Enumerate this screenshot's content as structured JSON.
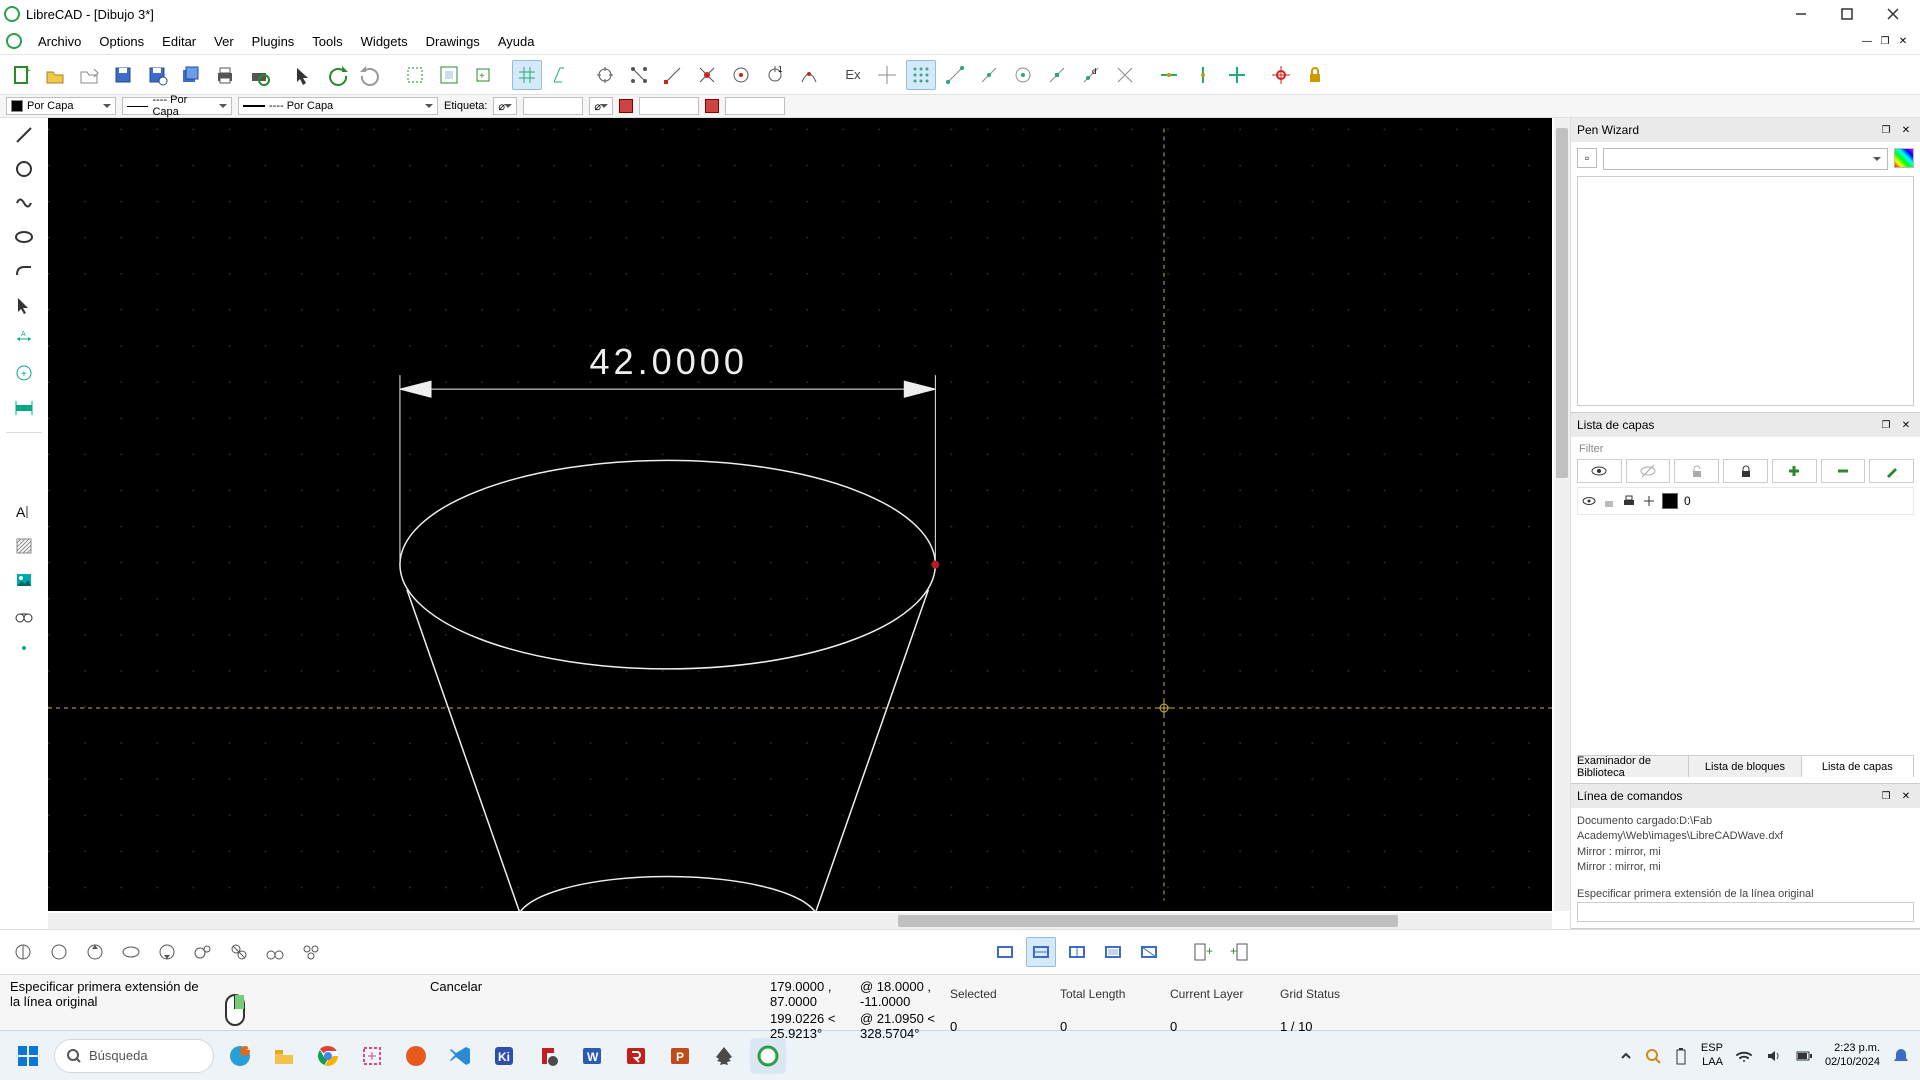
{
  "window_title": "LibreCAD - [Dibujo 3*]",
  "menu": [
    "Archivo",
    "Options",
    "Editar",
    "Ver",
    "Plugins",
    "Tools",
    "Widgets",
    "Drawings",
    "Ayuda"
  ],
  "propbar": {
    "layer_combo": "Por Capa",
    "linetype_combo": "---- Por Capa",
    "lineweight_combo": "---- Por Capa",
    "label_field": "Etiqueta:"
  },
  "right": {
    "pen_wizard_title": "Pen Wizard",
    "layers_title": "Lista de capas",
    "layers_filter_placeholder": "Filter",
    "layer0": "0",
    "tabs": [
      "Examinador de Biblioteca",
      "Lista de bloques",
      "Lista de capas"
    ],
    "cmd_title": "Línea de comandos",
    "cmd_log": "Documento cargado:D:\\Fab Academy\\Web\\images\\LibreCADWave.dxf\nMirror : mirror, mi\nMirror : mirror, mi",
    "cmd_hint": "Especificar primera extensión de la línea original"
  },
  "status": {
    "abs_coord": "179.0000 , 87.0000",
    "polar_coord": "199.0226 < 25.9213°",
    "rel_coord": "@  18.0000 , -11.0000",
    "rel_polar": "@  21.0950 < 328.5704°",
    "prompt": "Especificar primera extensión de la línea original",
    "cancel": "Cancelar",
    "headers": [
      "Selected",
      "Total Length",
      "Current Layer",
      "Grid Status"
    ],
    "values": [
      "0",
      "0",
      "0",
      "1 / 10"
    ]
  },
  "drawing": {
    "dim_label": "42.0000"
  },
  "taskbar": {
    "search_placeholder": "Búsqueda",
    "kb_layout": "ESP",
    "kb_sub": "LAA",
    "time": "2:23 p.m.",
    "date": "02/10/2024"
  }
}
